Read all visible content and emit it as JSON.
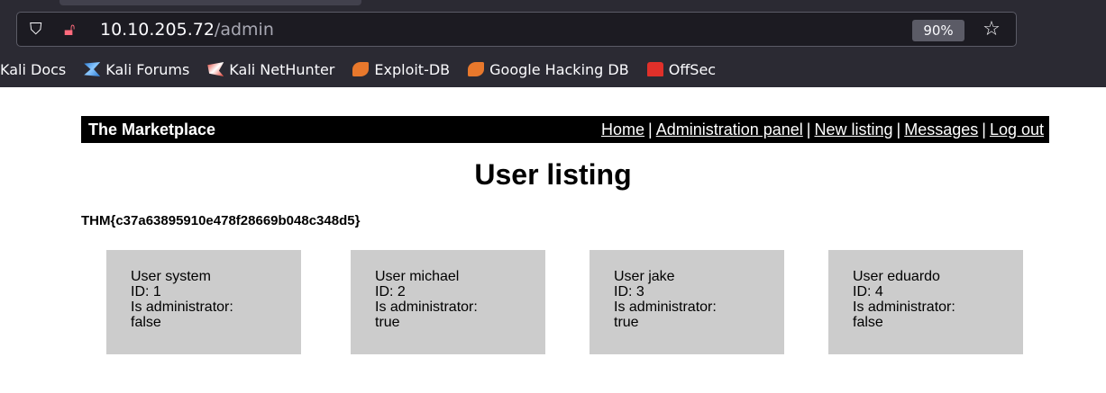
{
  "browser": {
    "url_host": "10.10.205.72",
    "url_path": "/admin",
    "zoom": "90%",
    "bookmarks": [
      {
        "label": "Kali Docs",
        "icon": "none"
      },
      {
        "label": "Kali Forums",
        "icon": "kali-dragon-icon"
      },
      {
        "label": "Kali NetHunter",
        "icon": "nethunter-icon"
      },
      {
        "label": "Exploit-DB",
        "icon": "exploit-db-icon"
      },
      {
        "label": "Google Hacking DB",
        "icon": "exploit-db-icon"
      },
      {
        "label": "OffSec",
        "icon": "offsec-icon"
      }
    ]
  },
  "site": {
    "title": "The Marketplace",
    "nav": {
      "home": "Home",
      "admin": "Administration panel",
      "new_listing": "New listing",
      "messages": "Messages",
      "logout": "Log out",
      "separator": "|"
    }
  },
  "main": {
    "heading": "User listing",
    "flag": "THM{c37a63895910e478f28669b048c348d5}",
    "users": [
      {
        "name": "User system",
        "id": "ID: 1",
        "admin_label": "Is administrator:",
        "admin_value": "false"
      },
      {
        "name": "User michael",
        "id": "ID: 2",
        "admin_label": "Is administrator:",
        "admin_value": "true"
      },
      {
        "name": "User jake",
        "id": "ID: 3",
        "admin_label": "Is administrator:",
        "admin_value": "true"
      },
      {
        "name": "User eduardo",
        "id": "ID: 4",
        "admin_label": "Is administrator:",
        "admin_value": "false"
      }
    ]
  }
}
